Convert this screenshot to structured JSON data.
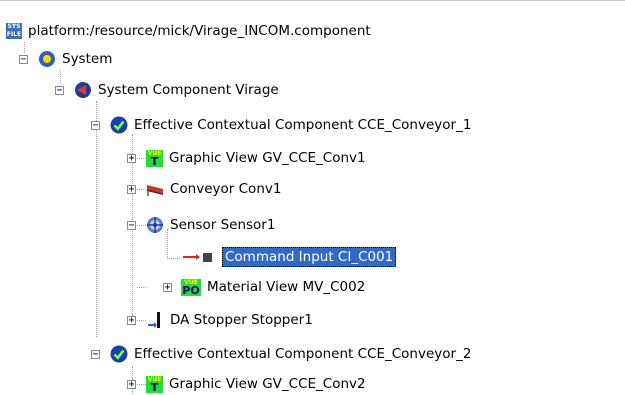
{
  "tree": {
    "root": {
      "label": "platform:/resource/mick/Virage_INCOM.component",
      "icon": "sys-file-icon",
      "icon_text_top": "SYS",
      "icon_text_bottom": "FILE"
    },
    "system": {
      "label": "System",
      "icon": "system-icon",
      "toggle": "−"
    },
    "component": {
      "label": "System Component Virage",
      "icon": "component-icon",
      "toggle": "−"
    },
    "cce1": {
      "label": "Effective Contextual Component CCE_Conveyor_1",
      "icon": "check-icon",
      "toggle": "−",
      "children": {
        "graphic_view": {
          "label": "Graphic View GV_CCE_Conv1",
          "icon": "vue-t-icon",
          "toggle": "+",
          "icon_top": "VUE",
          "icon_bottom": "T"
        },
        "conveyor": {
          "label": "Conveyor Conv1",
          "icon": "conveyor-icon",
          "toggle": "+"
        },
        "sensor": {
          "label": "Sensor Sensor1",
          "icon": "sensor-icon",
          "toggle": "−",
          "children": {
            "command_input": {
              "label": "Command Input CI_C001",
              "icon": "command-input-icon",
              "selected": true
            }
          }
        },
        "material_view": {
          "label": "Material View MV_C002",
          "icon": "vue-po-icon",
          "toggle": "+",
          "icon_top": "VUE",
          "icon_bottom": "PO"
        },
        "stopper": {
          "label": "DA Stopper Stopper1",
          "icon": "stopper-icon",
          "toggle": "+"
        }
      }
    },
    "cce2": {
      "label": "Effective Contextual Component CCE_Conveyor_2",
      "icon": "check-icon",
      "toggle": "−",
      "children": {
        "graphic_view": {
          "label": "Graphic View GV_CCE_Conv2",
          "icon": "vue-t-icon",
          "toggle": "+",
          "icon_top": "VUE",
          "icon_bottom": "T"
        }
      }
    }
  },
  "colors": {
    "selection": "#316ac5",
    "vue_bg": "#22dd33",
    "check": "#1a3fa8",
    "tree_lines": "#a0a0a0"
  }
}
